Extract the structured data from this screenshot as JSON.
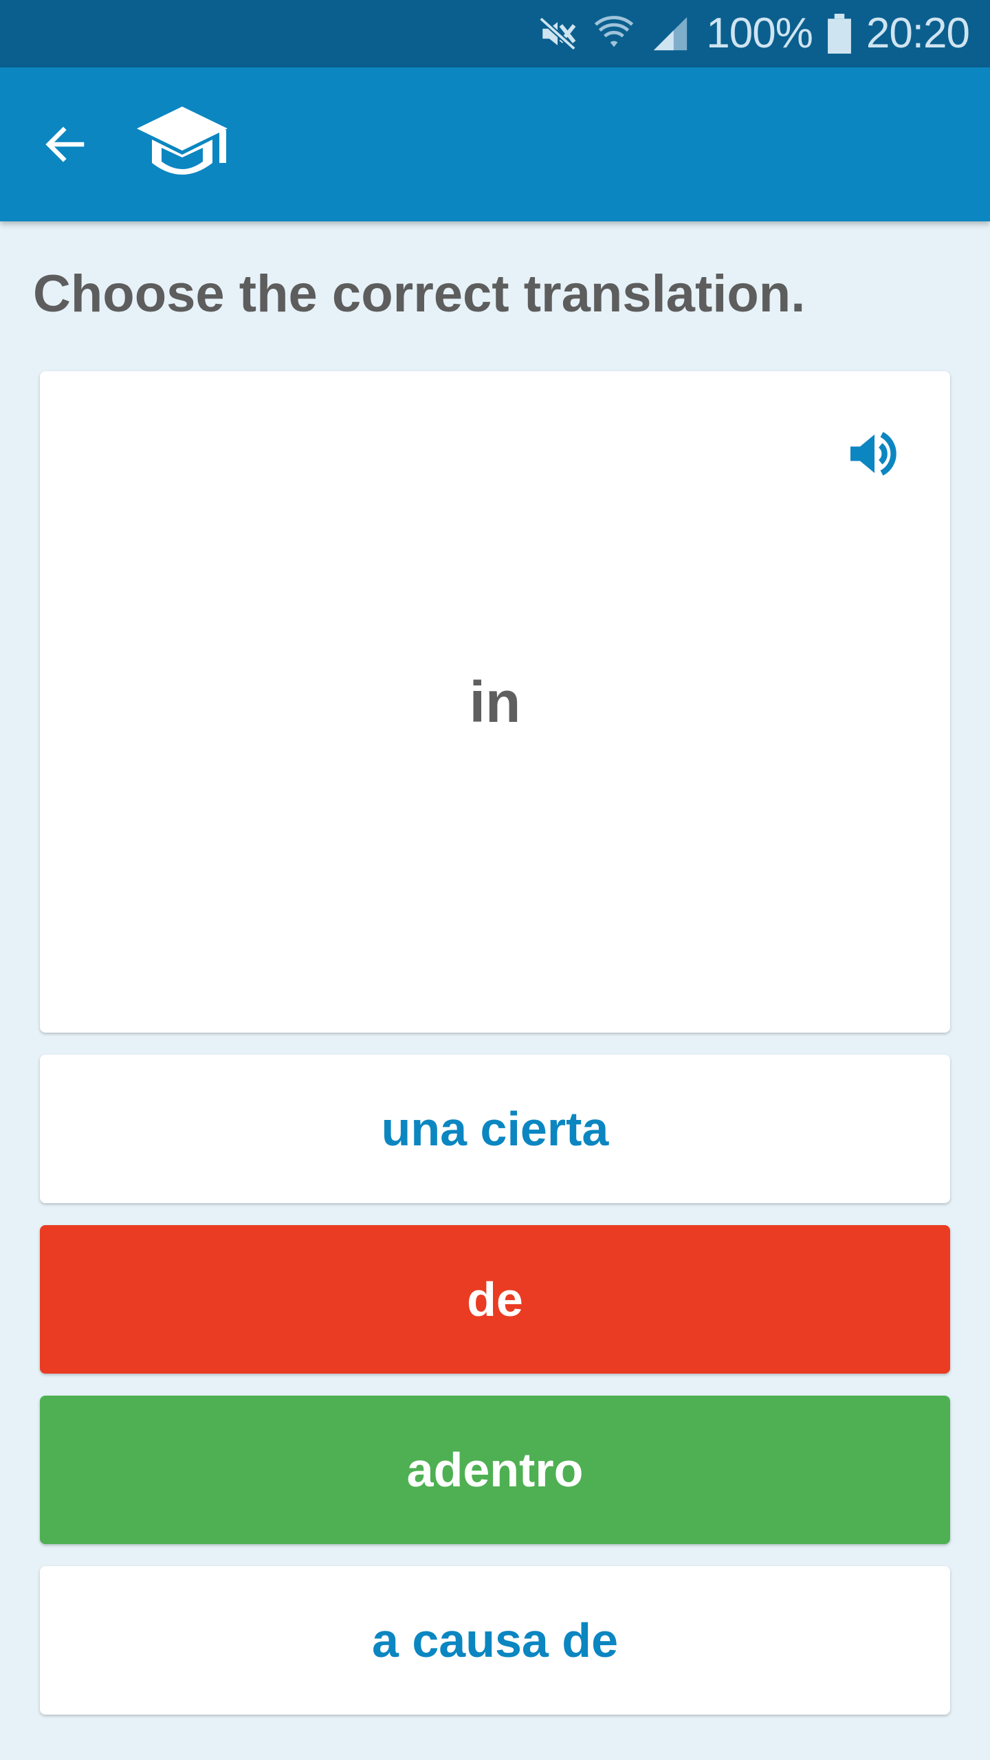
{
  "status_bar": {
    "battery_text": "100%",
    "time": "20:20",
    "icons": [
      "mute-icon",
      "wifi-icon",
      "signal-icon",
      "battery-icon"
    ]
  },
  "app_bar": {
    "back_icon": "arrow-left-icon",
    "logo_icon": "graduation-cap-icon"
  },
  "quiz": {
    "instruction": "Choose the correct translation.",
    "prompt_word": "in",
    "audio_icon": "speaker-icon",
    "options": [
      {
        "label": "una cierta",
        "state": "neutral"
      },
      {
        "label": "de",
        "state": "wrong"
      },
      {
        "label": "adentro",
        "state": "correct"
      },
      {
        "label": "a causa de",
        "state": "neutral"
      }
    ]
  },
  "colors": {
    "status_bar": "#0b5f8e",
    "app_bar": "#0b86c1",
    "background": "#e6f2f8",
    "wrong": "#e93c22",
    "correct": "#4eb052",
    "accent_text": "#0b86c1"
  }
}
